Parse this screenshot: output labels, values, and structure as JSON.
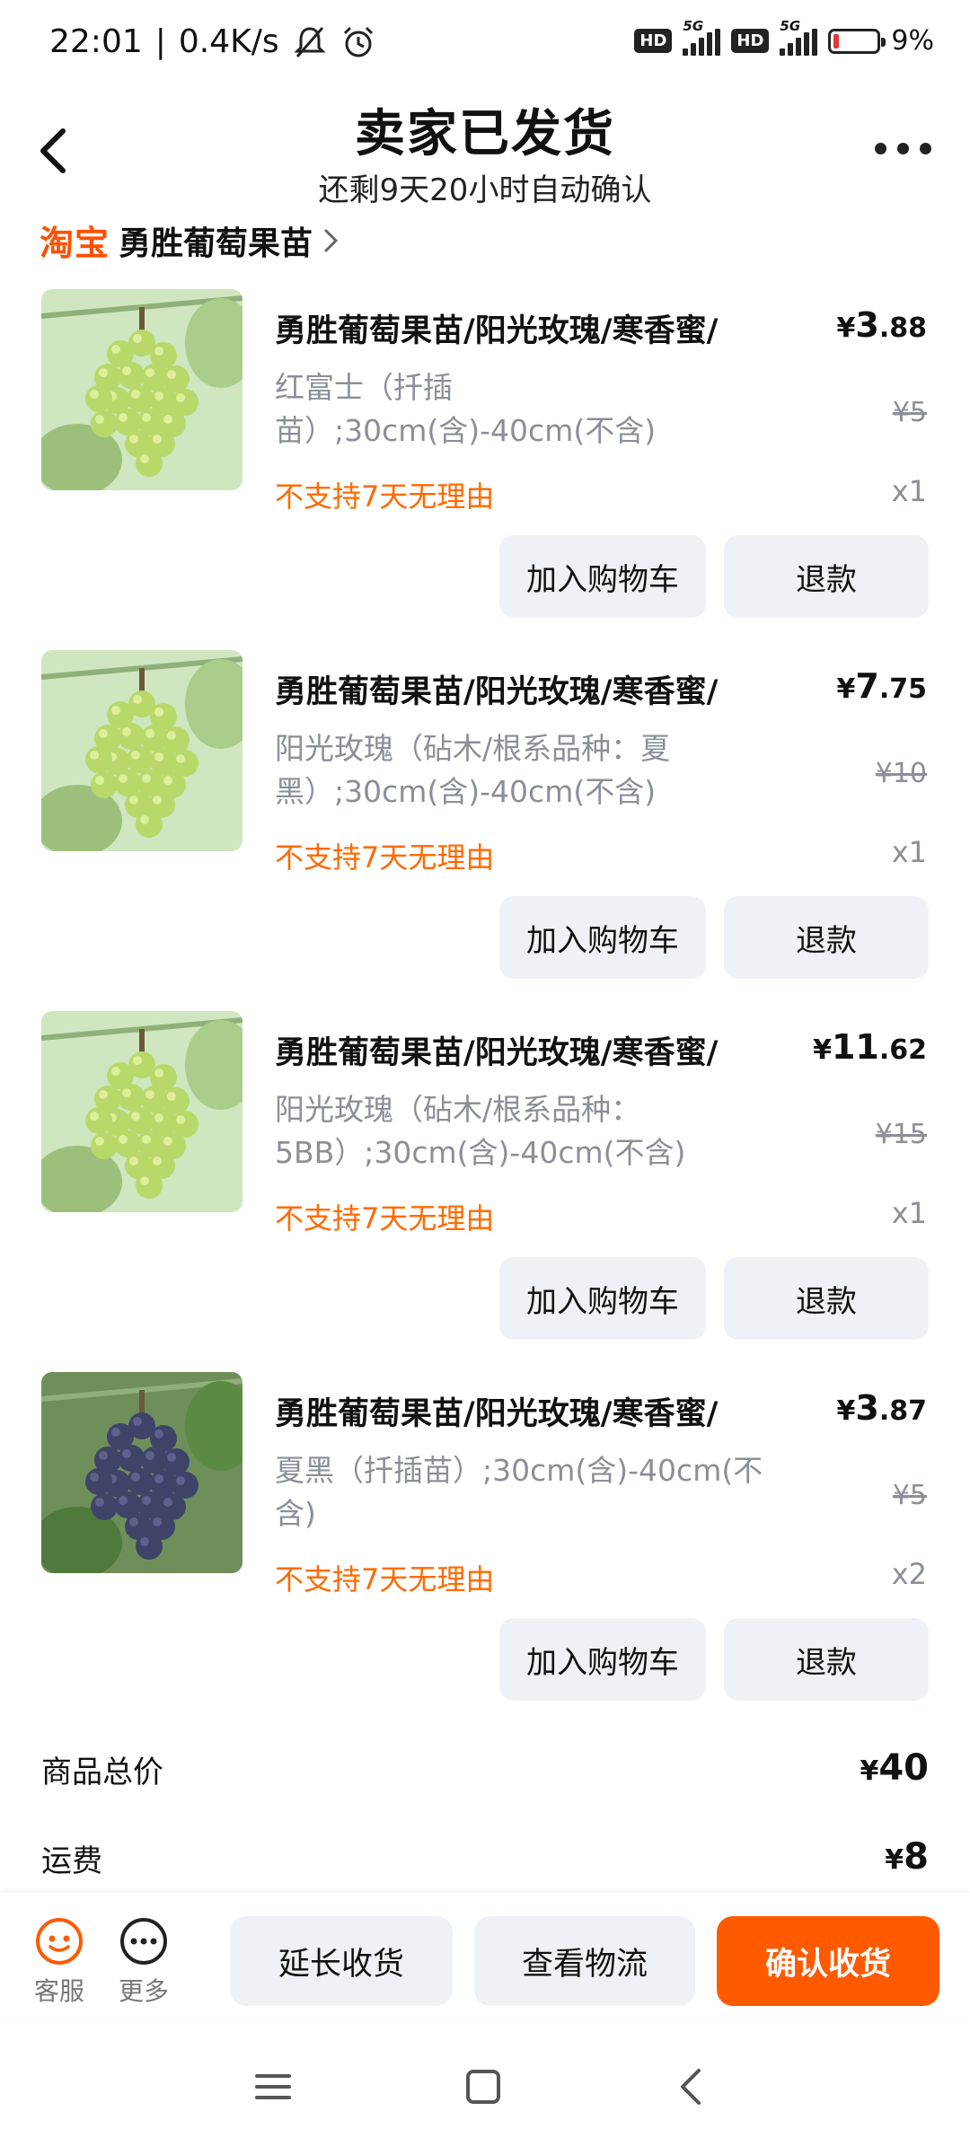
{
  "status_bar": {
    "time": "22:01",
    "speed": "0.4K/s",
    "hd1": "HD",
    "net1": "5G",
    "hd2": "HD",
    "net2": "5G",
    "battery": "9%"
  },
  "header": {
    "title": "卖家已发货",
    "subtitle": "还剩9天20小时自动确认"
  },
  "store": {
    "platform": "淘宝",
    "name": "勇胜葡萄果苗"
  },
  "products": [
    {
      "title": "勇胜葡萄果苗/阳光玫瑰/寒香蜜/",
      "price_symbol": "¥",
      "price_int": "3",
      "price_dec": ".88",
      "spec": "红富士（扦插苗）;30cm(含)-40cm(不含)",
      "orig_price": "¥5",
      "policy": "不支持7天无理由",
      "qty": "x1",
      "thumb_color": "green",
      "cart_label": "加入购物车",
      "refund_label": "退款"
    },
    {
      "title": "勇胜葡萄果苗/阳光玫瑰/寒香蜜/",
      "price_symbol": "¥",
      "price_int": "7",
      "price_dec": ".75",
      "spec": "阳光玫瑰（砧木/根系品种：夏黑）;30cm(含)-40cm(不含)",
      "orig_price": "¥10",
      "policy": "不支持7天无理由",
      "qty": "x1",
      "thumb_color": "green",
      "cart_label": "加入购物车",
      "refund_label": "退款"
    },
    {
      "title": "勇胜葡萄果苗/阳光玫瑰/寒香蜜/",
      "price_symbol": "¥",
      "price_int": "11",
      "price_dec": ".62",
      "spec": "阳光玫瑰（砧木/根系品种：5BB）;30cm(含)-40cm(不含)",
      "orig_price": "¥15",
      "policy": "不支持7天无理由",
      "qty": "x1",
      "thumb_color": "green",
      "cart_label": "加入购物车",
      "refund_label": "退款"
    },
    {
      "title": "勇胜葡萄果苗/阳光玫瑰/寒香蜜/",
      "price_symbol": "¥",
      "price_int": "3",
      "price_dec": ".87",
      "spec": "夏黑（扦插苗）;30cm(含)-40cm(不含)",
      "orig_price": "¥5",
      "policy": "不支持7天无理由",
      "qty": "x2",
      "thumb_color": "purple",
      "cart_label": "加入购物车",
      "refund_label": "退款"
    }
  ],
  "totals": {
    "goods_label": "商品总价",
    "goods_symbol": "¥",
    "goods_value": "40",
    "shipping_label": "运费",
    "shipping_symbol": "¥",
    "shipping_value": "8"
  },
  "bottom_bar": {
    "service_label": "客服",
    "more_label": "更多",
    "extend_label": "延长收货",
    "logistics_label": "查看物流",
    "confirm_label": "确认收货"
  },
  "colors": {
    "accent": "#ff5a00",
    "taobao": "#ff5000",
    "policy": "#ff6a00",
    "muted": "#8a8f98",
    "button_bg": "#eef1f6"
  }
}
